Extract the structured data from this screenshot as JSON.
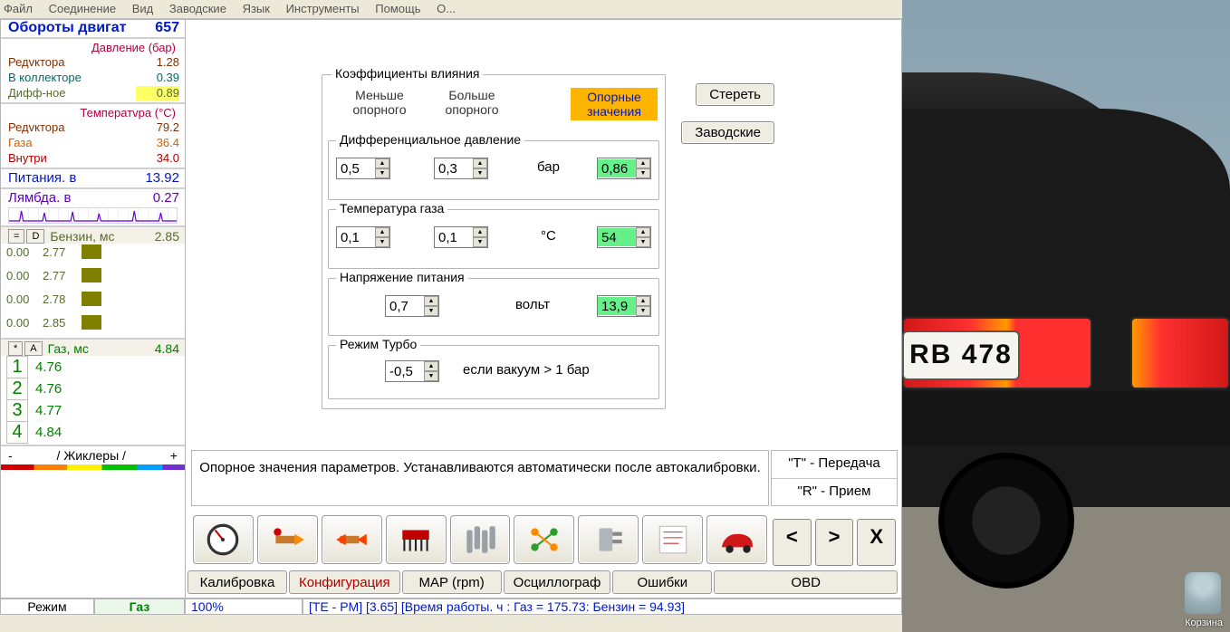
{
  "menu": {
    "items": [
      "Файл",
      "Соединение",
      "Вид",
      "Заводские",
      "Язык",
      "Инструменты",
      "Помощь",
      "О..."
    ]
  },
  "sidebar": {
    "rpm": {
      "label": "Обороты двигат",
      "value": "657"
    },
    "press_hdr": "Давление (бар)",
    "press": [
      {
        "label": "Редvктора",
        "value": "1.28",
        "cls": "brown"
      },
      {
        "label": "В коллекторе",
        "value": "0.39",
        "cls": "teal"
      },
      {
        "label": "Дифф-ное",
        "value": "0.89",
        "cls": "olive",
        "hl": true
      }
    ],
    "temp_hdr": "Температvра (°C)",
    "temp": [
      {
        "label": "Редvктора",
        "value": "79.2",
        "cls": "brown"
      },
      {
        "label": "Газа",
        "value": "36.4",
        "cls": "orange"
      },
      {
        "label": "Внутри",
        "value": "34.0",
        "cls": "red"
      }
    ],
    "supply": {
      "label": "Питания. в",
      "value": "13.92"
    },
    "lambda": {
      "label": "Лямбда. в",
      "value": "0.27"
    },
    "petrol_hdr": {
      "btn1": "=",
      "btn2": "D",
      "label": "Бензин, мс",
      "value": "2.85"
    },
    "petrol": [
      {
        "a": "0.00",
        "b": "2.77"
      },
      {
        "a": "0.00",
        "b": "2.77"
      },
      {
        "a": "0.00",
        "b": "2.78"
      },
      {
        "a": "0.00",
        "b": "2.85"
      }
    ],
    "gas_hdr": {
      "btn1": "*",
      "btn2": "A",
      "label": "Газ, мс",
      "value": "4.84"
    },
    "gas": [
      {
        "n": "1",
        "v": "4.76"
      },
      {
        "n": "2",
        "v": "4.76"
      },
      {
        "n": "3",
        "v": "4.77"
      },
      {
        "n": "4",
        "v": "4.84"
      }
    ],
    "jiklery": {
      "minus": "-",
      "label": "Жиклеры",
      "plus": "+"
    }
  },
  "work": {
    "group_title": "Коэффициенты влияния",
    "col1": "Меньше опорного",
    "col2": "Больше опорного",
    "ref": "Опорные значения",
    "btn_clear": "Стереть",
    "btn_factory": "Заводские",
    "rows": {
      "diff": {
        "title": "Дифференциальное давление",
        "a": "0,5",
        "b": "0,3",
        "unit": "бар",
        "ref": "0,86"
      },
      "tgas": {
        "title": "Температура газа",
        "a": "0,1",
        "b": "0,1",
        "unit": "°C",
        "ref": "54"
      },
      "volt": {
        "title": "Напряжение питания",
        "b": "0,7",
        "unit": "вольт",
        "ref": "13,9"
      },
      "turbo": {
        "title": "Режим Турбо",
        "b": "-0,5",
        "note": "если вакуум > 1 бар"
      }
    },
    "hint": "Опорное значения параметров. Устанавливаются автоматически после автокалибровки.",
    "comm": {
      "t": "\"T\" - Передача",
      "r": "\"R\" - Прием"
    },
    "nav": {
      "prev": "<",
      "next": ">",
      "close": "X"
    },
    "tabs": [
      "Калибровка",
      "Конфигурация",
      "MAP (rpm)",
      "Осциллограф",
      "Ошибки",
      "OBD"
    ],
    "active_tab": "Конфигурация"
  },
  "status": {
    "mode_lbl": "Режим",
    "mode_val": "Газ",
    "percent": "100%",
    "info": "[TE - PM] [3.65] [Время работы. ч : Газ = 175.73: Бензин =  94.93]"
  },
  "desktop": {
    "plate": "RB 478",
    "trash": "Корзина"
  }
}
